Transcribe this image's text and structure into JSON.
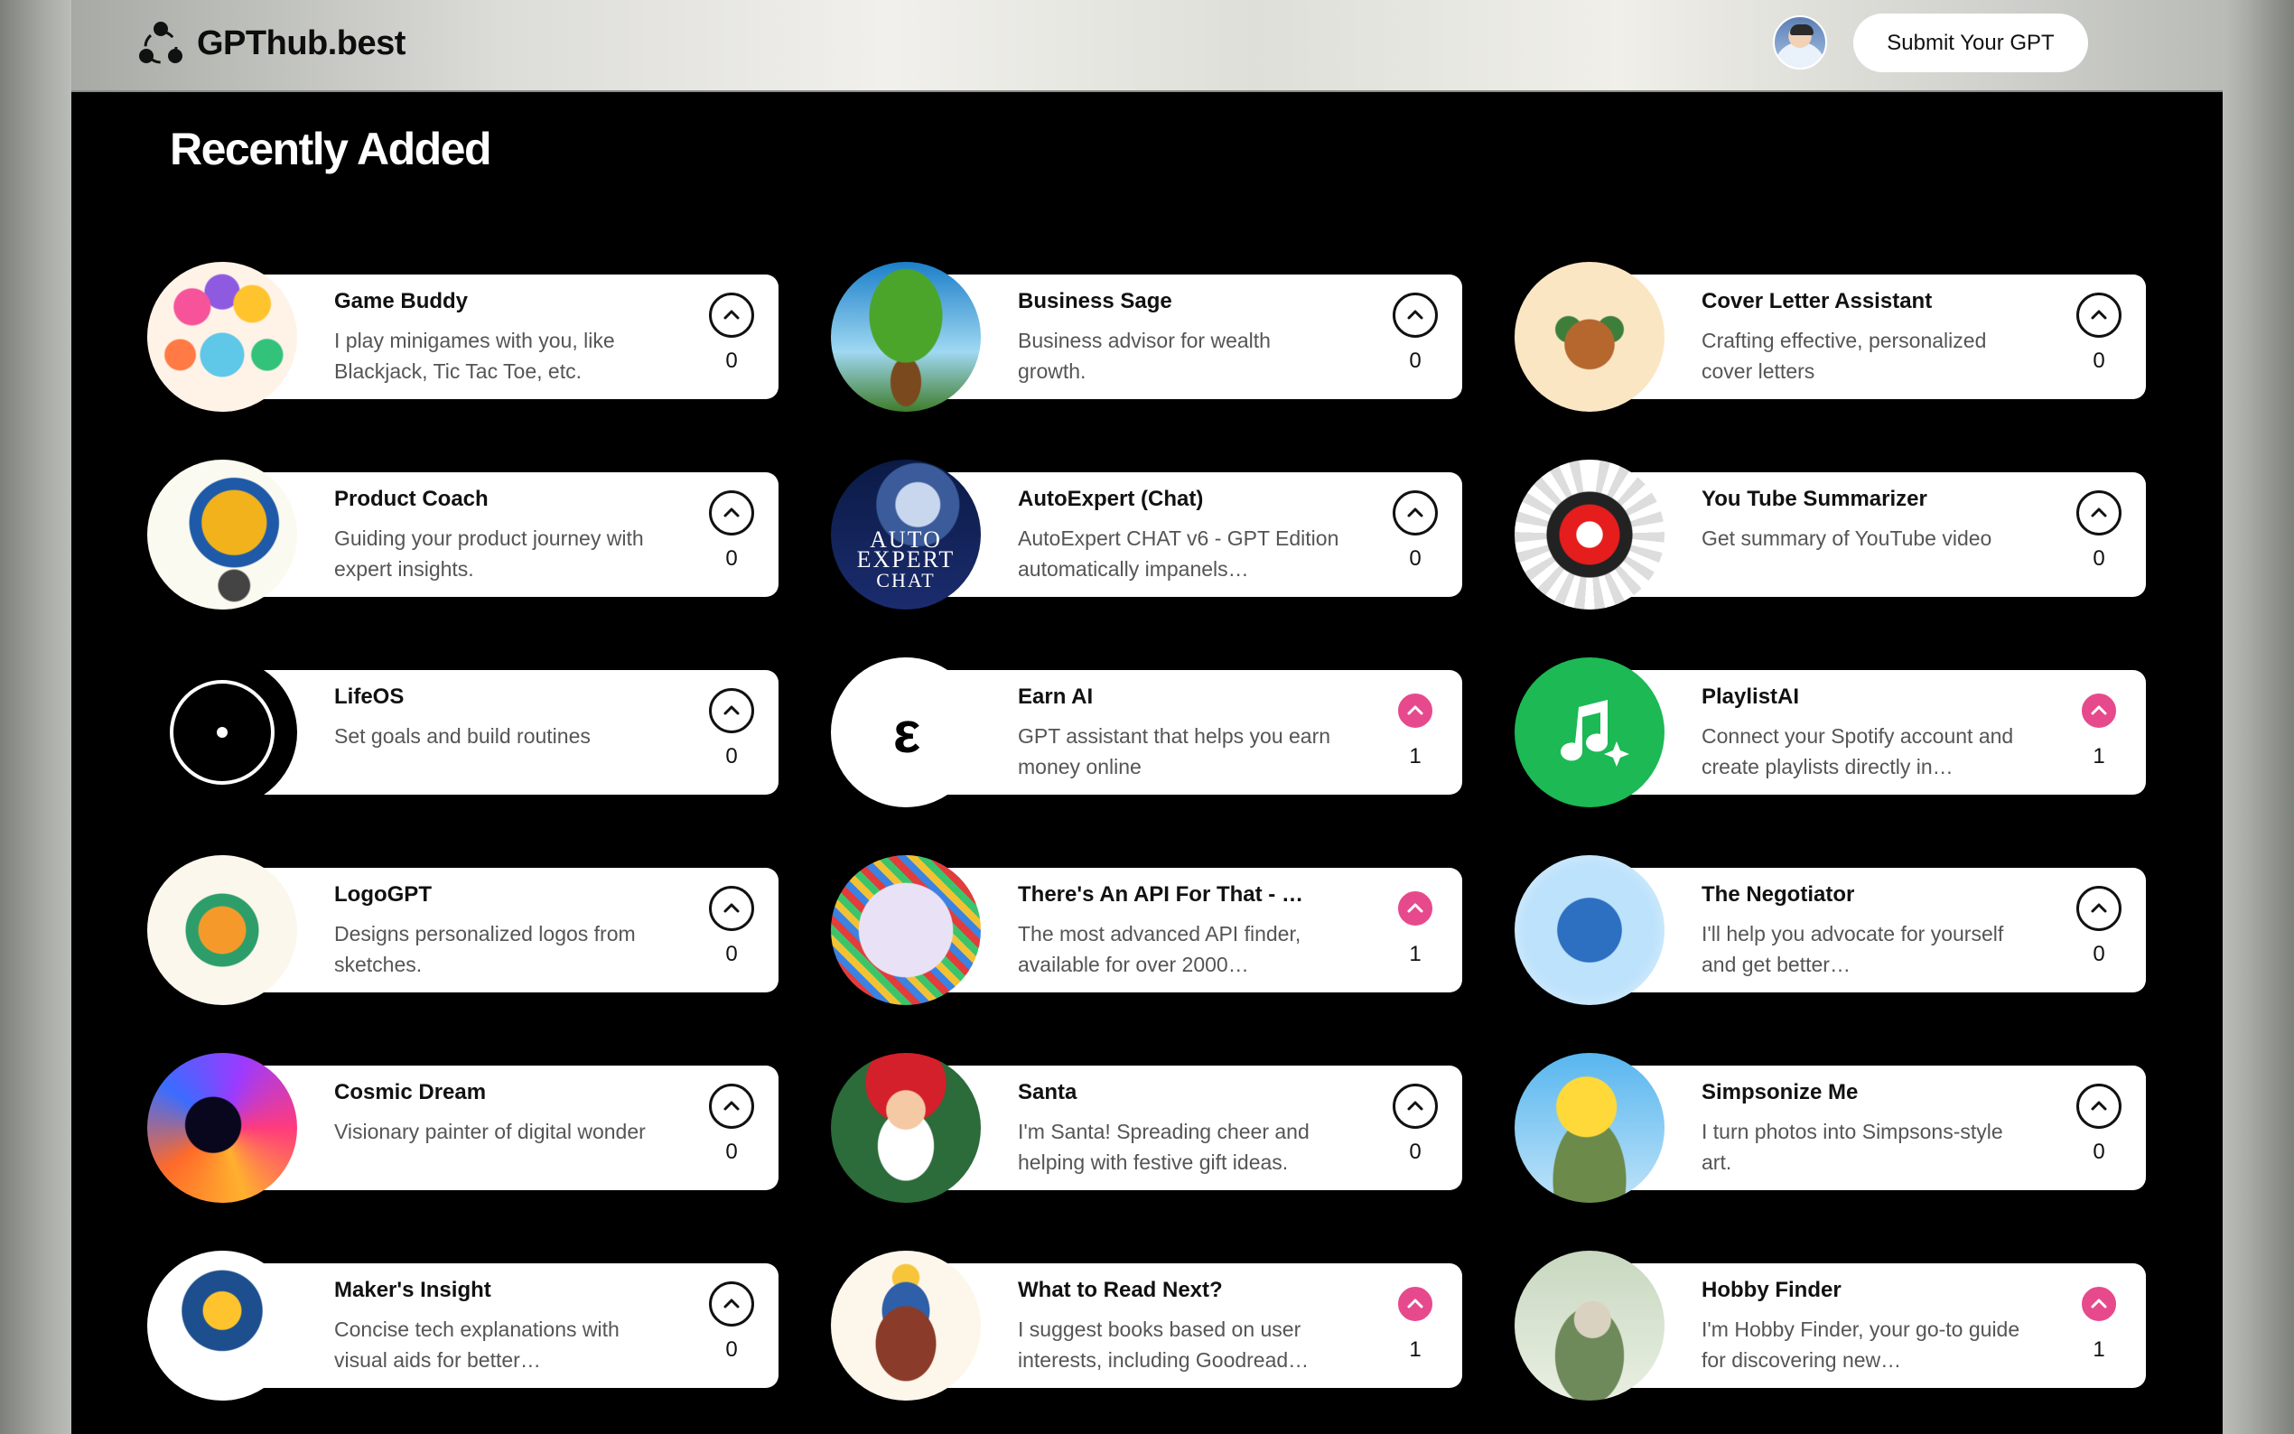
{
  "brand": {
    "name": "GPThub.best",
    "icon": "three-dots-logo-icon"
  },
  "header": {
    "submit_label": "Submit Your GPT",
    "avatar": "user-avatar"
  },
  "page": {
    "heading": "Recently Added"
  },
  "colors": {
    "upvoted": "#e64a8d",
    "background": "#000000",
    "card": "#ffffff"
  },
  "cards": [
    {
      "title": "Game Buddy",
      "desc": "I play minigames with you, like Blackjack, Tic Tac Toe, etc.",
      "votes": "0",
      "voted": false,
      "thumb": "robot-cards-thumbnail"
    },
    {
      "title": "Business Sage",
      "desc": "Business advisor for wealth growth.",
      "votes": "0",
      "voted": false,
      "thumb": "money-tree-thumbnail"
    },
    {
      "title": "Cover Letter Assistant",
      "desc": "Crafting effective, personalized cover letters",
      "votes": "0",
      "voted": false,
      "thumb": "briefcase-email-thumbnail"
    },
    {
      "title": "Product Coach",
      "desc": "Guiding your product journey with expert insights.",
      "votes": "0",
      "voted": false,
      "thumb": "lightbulb-gears-thumbnail"
    },
    {
      "title": "AutoExpert (Chat)",
      "desc": "AutoExpert CHAT v6 - GPT Edition automatically impanels…",
      "votes": "0",
      "voted": false,
      "thumb": "autoexpert-chat-thumbnail"
    },
    {
      "title": "You Tube Summarizer",
      "desc": "Get summary of YouTube video",
      "votes": "0",
      "voted": false,
      "thumb": "youtube-doodle-thumbnail"
    },
    {
      "title": "LifeOS",
      "desc": "Set goals and build routines",
      "votes": "0",
      "voted": false,
      "thumb": "lifeos-circle-thumbnail"
    },
    {
      "title": "Earn AI",
      "desc": "GPT assistant that helps you earn money online",
      "votes": "1",
      "voted": true,
      "thumb": "earn-ai-logo-thumbnail"
    },
    {
      "title": "PlaylistAI",
      "desc": "Connect your Spotify account and create playlists directly in…",
      "votes": "1",
      "voted": true,
      "thumb": "music-note-sparkle-thumbnail"
    },
    {
      "title": "LogoGPT",
      "desc": "Designs personalized logos from sketches.",
      "votes": "0",
      "voted": false,
      "thumb": "pencil-logo-thumbnail"
    },
    {
      "title": "There's An API For That - The…",
      "desc": "The most advanced API finder, available for over 2000…",
      "votes": "1",
      "voted": true,
      "thumb": "api-cloud-thumbnail"
    },
    {
      "title": "The Negotiator",
      "desc": "I'll help you advocate for yourself and get better…",
      "votes": "0",
      "voted": false,
      "thumb": "blue-flower-thumbnail"
    },
    {
      "title": "Cosmic Dream",
      "desc": "Visionary painter of digital wonder",
      "votes": "0",
      "voted": false,
      "thumb": "cosmic-swirl-thumbnail"
    },
    {
      "title": "Santa",
      "desc": "I'm Santa! Spreading cheer and helping with festive gift ideas.",
      "votes": "0",
      "voted": false,
      "thumb": "santa-thumbnail"
    },
    {
      "title": "Simpsonize Me",
      "desc": "I turn photos into Simpsons-style art.",
      "votes": "0",
      "voted": false,
      "thumb": "simpsons-character-thumbnail"
    },
    {
      "title": "Maker's Insight",
      "desc": "Concise tech explanations with visual aids for better…",
      "votes": "0",
      "voted": false,
      "thumb": "circuit-bulb-thumbnail"
    },
    {
      "title": "What to Read Next?",
      "desc": "I suggest books based on user interests, including Goodread…",
      "votes": "1",
      "voted": true,
      "thumb": "book-stack-thumbnail"
    },
    {
      "title": "Hobby Finder",
      "desc": "I'm Hobby Finder, your go-to guide for discovering new…",
      "votes": "1",
      "voted": true,
      "thumb": "hobby-robot-thumbnail"
    }
  ]
}
